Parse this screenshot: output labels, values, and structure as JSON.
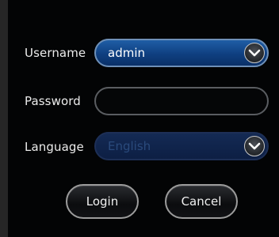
{
  "form": {
    "username_label": "Username",
    "username_value": "admin",
    "password_label": "Password",
    "password_value": "",
    "language_label": "Language",
    "language_value": "English"
  },
  "actions": {
    "login_label": "Login",
    "cancel_label": "Cancel"
  },
  "icons": {
    "dropdown": "chevron-down-icon"
  },
  "colors": {
    "field_active": "#1a5299",
    "field_disabled": "#0f2148",
    "background": "#030405"
  }
}
